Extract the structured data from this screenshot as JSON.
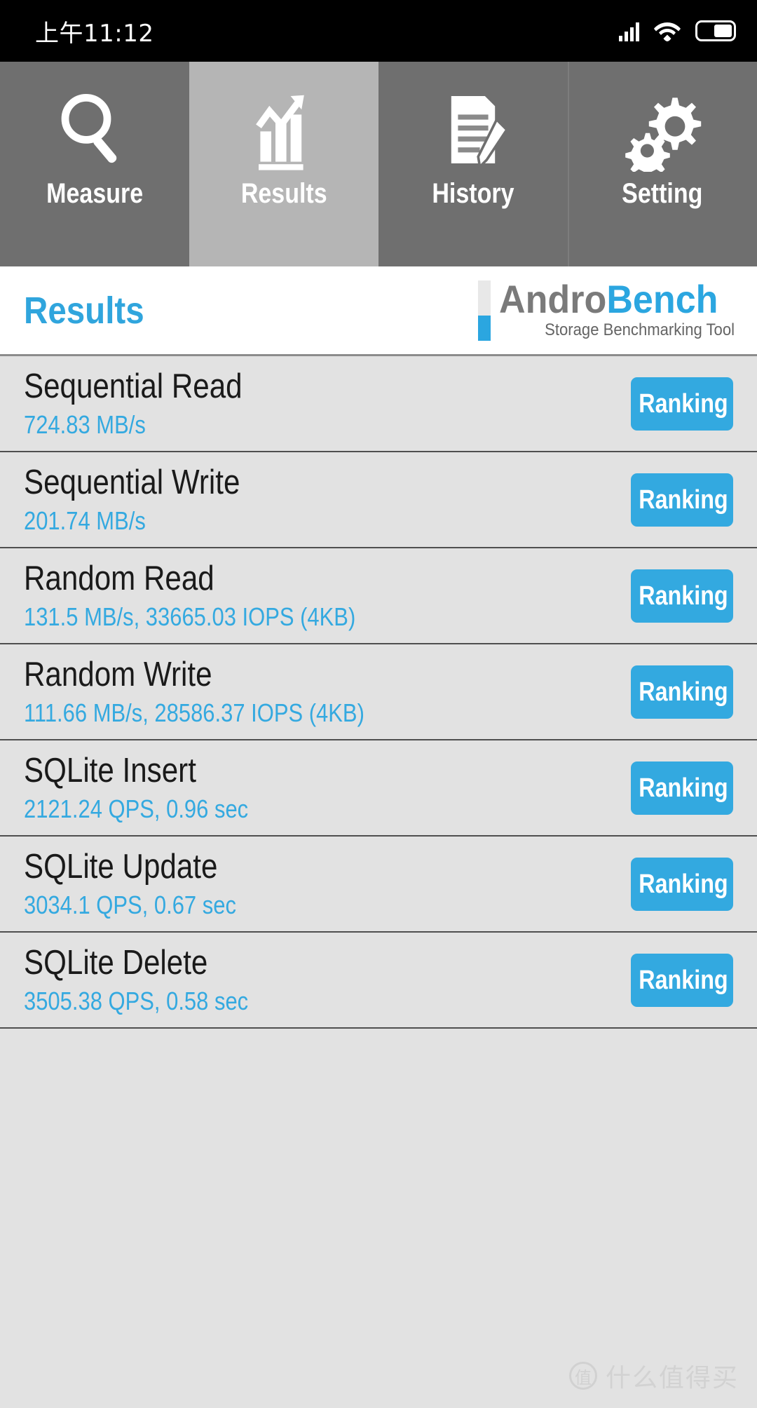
{
  "status_bar": {
    "time": "上午11:12",
    "icons": [
      "signal-icon",
      "wifi-icon",
      "battery-icon"
    ]
  },
  "tabs": [
    {
      "label": "Measure",
      "icon": "magnifier-icon",
      "active": false
    },
    {
      "label": "Results",
      "icon": "bar-chart-icon",
      "active": true
    },
    {
      "label": "History",
      "icon": "document-pen-icon",
      "active": false
    },
    {
      "label": "Setting",
      "icon": "gears-icon",
      "active": false
    }
  ],
  "header": {
    "page_title": "Results",
    "logo_main_first": "Andro",
    "logo_main_second": "Bench",
    "logo_subtitle": "Storage Benchmarking Tool"
  },
  "results": [
    {
      "name": "Sequential Read",
      "value": "724.83 MB/s",
      "button": "Ranking"
    },
    {
      "name": "Sequential Write",
      "value": "201.74 MB/s",
      "button": "Ranking"
    },
    {
      "name": "Random Read",
      "value": "131.5 MB/s, 33665.03 IOPS (4KB)",
      "button": "Ranking"
    },
    {
      "name": "Random Write",
      "value": "111.66 MB/s, 28586.37 IOPS (4KB)",
      "button": "Ranking"
    },
    {
      "name": "SQLite Insert",
      "value": "2121.24 QPS, 0.96 sec",
      "button": "Ranking"
    },
    {
      "name": "SQLite Update",
      "value": "3034.1 QPS, 0.67 sec",
      "button": "Ranking"
    },
    {
      "name": "SQLite Delete",
      "value": "3505.38 QPS, 0.58 sec",
      "button": "Ranking"
    }
  ],
  "watermark": {
    "mark": "值",
    "text": "什么值得买"
  },
  "colors": {
    "accent_blue": "#33a9e0",
    "tab_bg": "#6f6f6f",
    "tab_active_bg": "#b5b5b5",
    "list_bg": "#e2e2e2",
    "logo_gray": "#7a7a7a"
  }
}
